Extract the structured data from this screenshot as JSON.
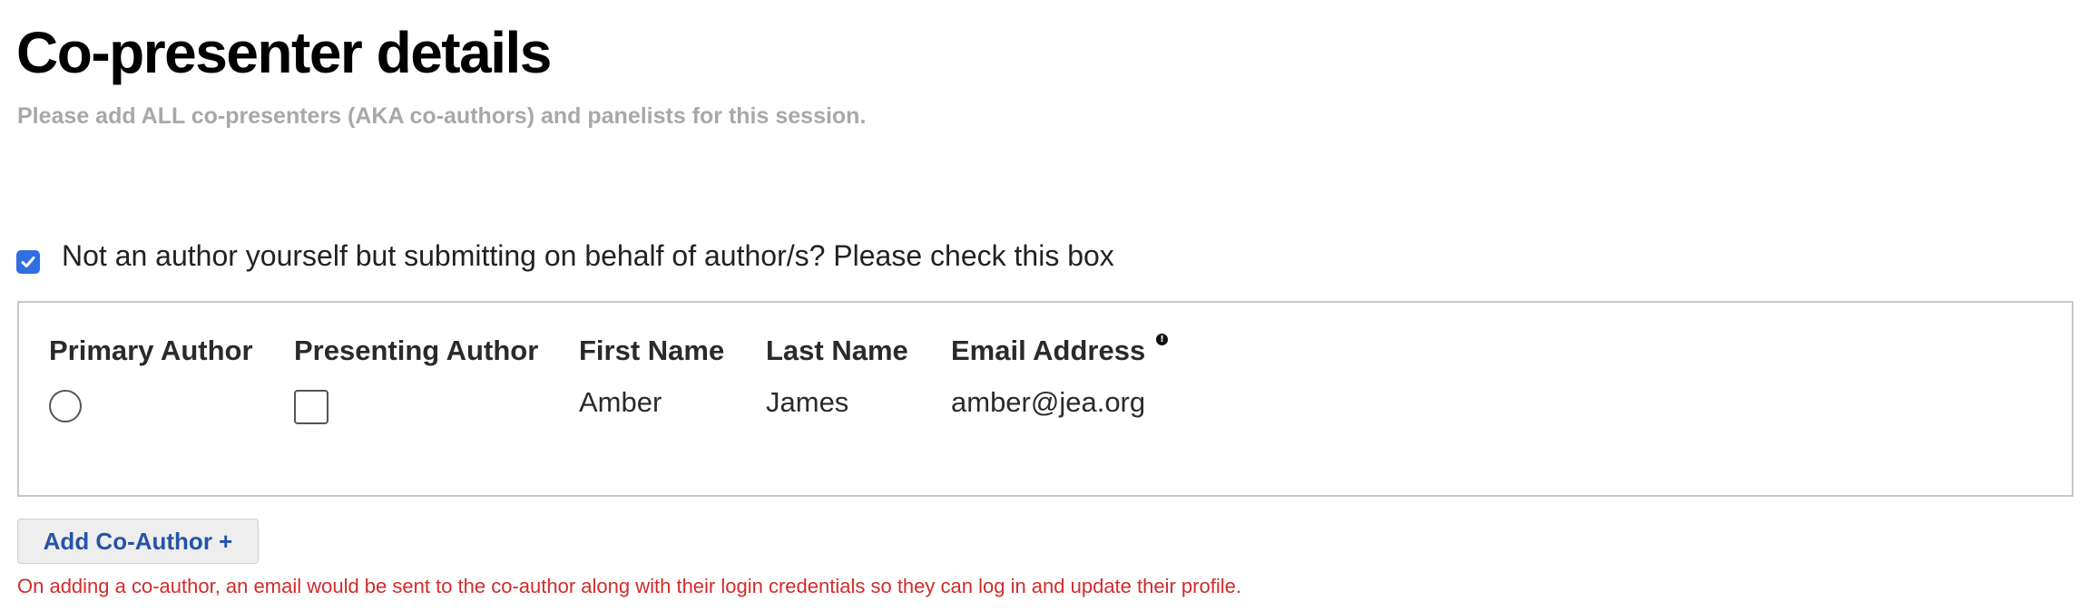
{
  "page": {
    "title": "Co-presenter details",
    "subtitle": "Please add ALL co-presenters (AKA co-authors) and panelists for this session."
  },
  "behalf": {
    "checked": true,
    "label": "Not an author yourself but submitting on behalf of author/s? Please check this box"
  },
  "table": {
    "columns": {
      "primary": "Primary Author",
      "presenting": "Presenting Author",
      "first_name": "First Name",
      "last_name": "Last Name",
      "email": "Email Address",
      "email_info_icon": "!"
    },
    "rows": [
      {
        "primary_selected": false,
        "presenting_checked": false,
        "first_name": "Amber",
        "last_name": "James",
        "email": "amber@jea.org"
      }
    ]
  },
  "actions": {
    "add_coauthor_label": "Add Co-Author +"
  },
  "notice": {
    "text": "On adding a co-author, an email would be sent to the co-author along with their login credentials so they can log in and update their profile."
  },
  "colors": {
    "accent": "#2f6fe0",
    "link": "#2553a8",
    "warning": "#d22b2b",
    "muted": "#a8a8a8"
  },
  "icons": {
    "behalf_checkbox": "check-icon",
    "email_info": "info-icon"
  }
}
